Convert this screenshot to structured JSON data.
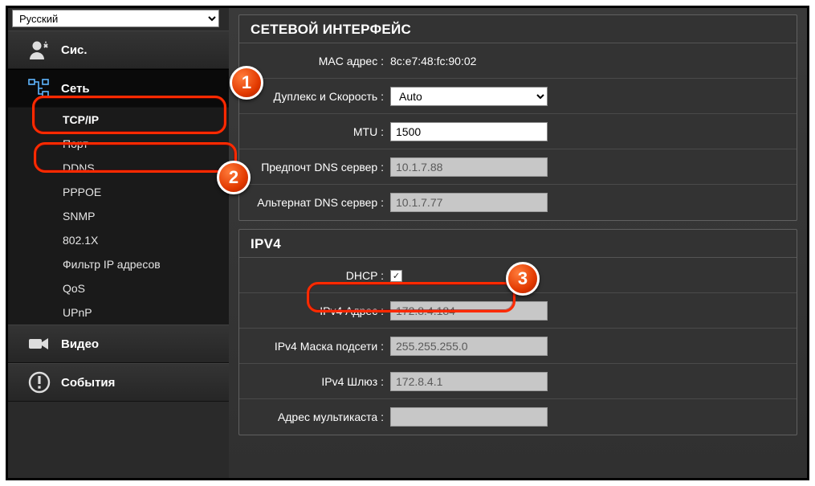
{
  "language": {
    "selected": "Русский"
  },
  "sidebar": {
    "groups": {
      "system": "Сис.",
      "network": "Сеть",
      "video": "Видео",
      "events": "События"
    },
    "network_items": [
      "TCP/IP",
      "Порт",
      "DDNS",
      "PPPOE",
      "SNMP",
      "802.1X",
      "Фильтр IP адресов",
      "QoS",
      "UPnP"
    ]
  },
  "panel1": {
    "title": "СЕТЕВОЙ ИНТЕРФЕЙС",
    "mac_label": "MAC адрес :",
    "mac_value": "8c:e7:48:fc:90:02",
    "duplex_label": "Дуплекс и Скорость :",
    "duplex_value": "Auto",
    "mtu_label": "MTU :",
    "mtu_value": "1500",
    "pref_dns_label": "Предпочт DNS сервер :",
    "pref_dns_value": "10.1.7.88",
    "alt_dns_label": "Альтернат DNS сервер :",
    "alt_dns_value": "10.1.7.77"
  },
  "panel2": {
    "title": "IPV4",
    "dhcp_label": "DHCP :",
    "dhcp_checked": "✓",
    "ip_label": "IPv4 Адрес :",
    "ip_value": "172.8.4.184",
    "mask_label": "IPv4 Маска подсети :",
    "mask_value": "255.255.255.0",
    "gw_label": "IPv4 Шлюз :",
    "gw_value": "172.8.4.1",
    "mcast_label": "Адрес мультикаста :",
    "mcast_value": ""
  },
  "badges": {
    "b1": "1",
    "b2": "2",
    "b3": "3"
  }
}
